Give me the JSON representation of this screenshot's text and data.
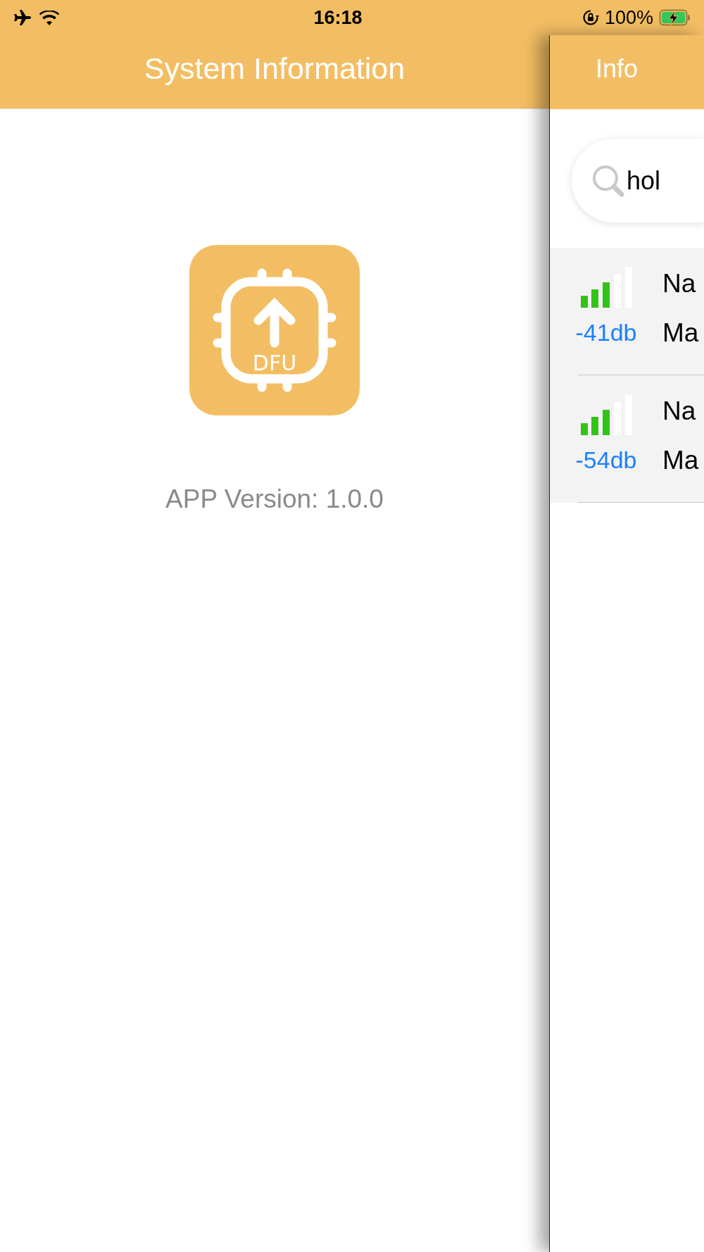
{
  "status_bar": {
    "time": "16:18",
    "battery": "100%"
  },
  "system_panel": {
    "title": "System Information",
    "app_icon_label": "DFU",
    "version": "APP Version: 1.0.0"
  },
  "device_panel": {
    "title": "Info",
    "search": {
      "value": "hol"
    },
    "devices": [
      {
        "rssi": "-41db",
        "line_1": "Na",
        "line_2": "Ma"
      },
      {
        "rssi": "-54db",
        "line_1": "Na",
        "line_2": "Ma"
      }
    ]
  }
}
